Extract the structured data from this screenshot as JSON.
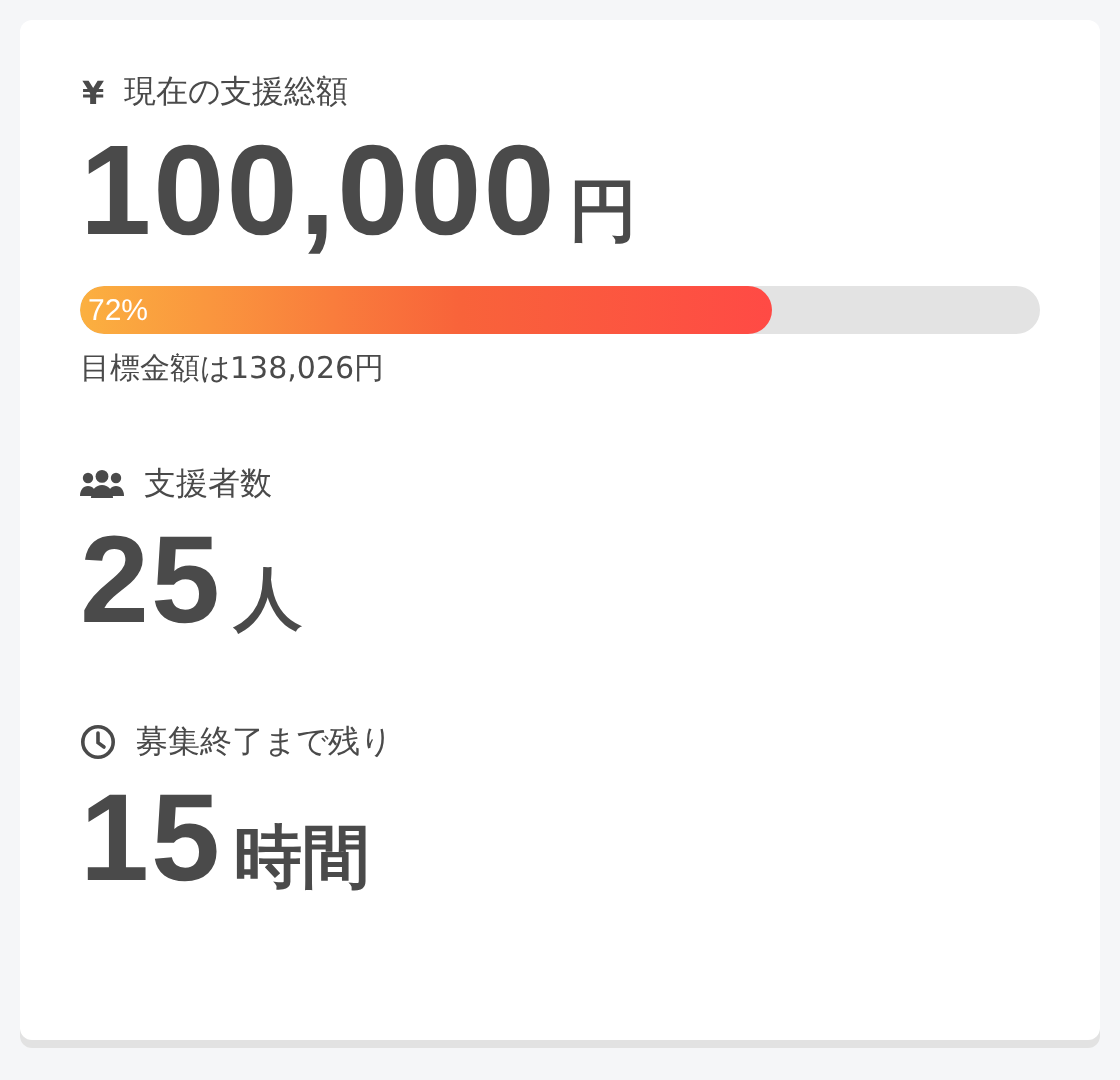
{
  "stats": [
    {
      "kind": "amount",
      "icon": "¥",
      "label": "現在の支援総額",
      "value": "100,000",
      "unit": "円",
      "progress": {
        "level": 0.72,
        "label": "72%"
      },
      "note": "目標金額は138,026円"
    },
    {
      "kind": "supporters",
      "label": "支援者数",
      "value": "25",
      "unit": "人"
    },
    {
      "kind": "time",
      "label": "募集終了まで残り",
      "value": "15",
      "unit": "時間"
    }
  ]
}
